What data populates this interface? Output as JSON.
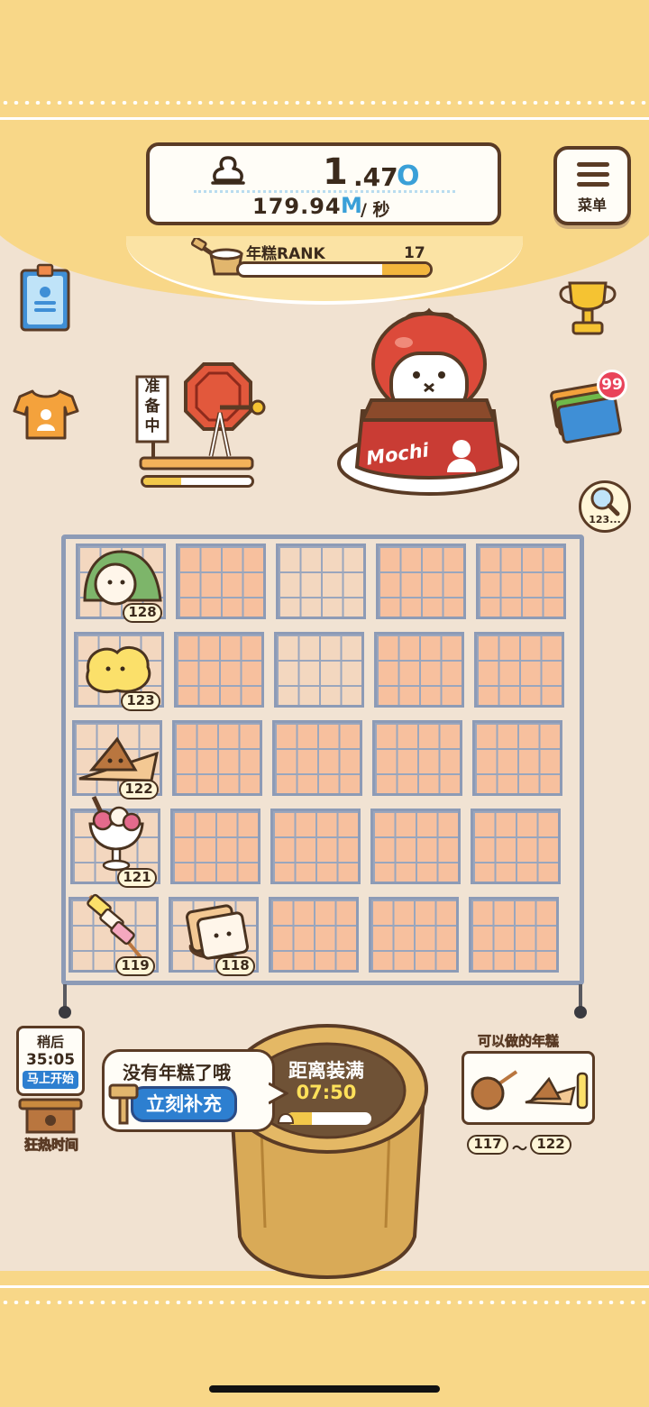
{
  "stats": {
    "mochi_count_int": "1",
    "mochi_count_frac": ".47",
    "mochi_count_unit": "O",
    "rate_value": "179.94",
    "rate_unit": "M",
    "rate_per": "/ 秒"
  },
  "menu": {
    "label": "菜单"
  },
  "rank": {
    "label": "年糕RANK",
    "level": "17",
    "progress": 0.25
  },
  "machine": {
    "sign": [
      "准",
      "备",
      "中"
    ],
    "progress": 0.35
  },
  "stall": {
    "sign_text": "Mochi"
  },
  "cards": {
    "badge": "99"
  },
  "search": {
    "label": "123..."
  },
  "grid": {
    "rows": 5,
    "cols": 5,
    "items": [
      {
        "row": 0,
        "col": 0,
        "level": "128",
        "kind": "green-wrapped-mochi"
      },
      {
        "row": 1,
        "col": 0,
        "level": "123",
        "kind": "yellow-mochi"
      },
      {
        "row": 2,
        "col": 0,
        "level": "122",
        "kind": "triangle-mochi"
      },
      {
        "row": 3,
        "col": 0,
        "level": "121",
        "kind": "mochi-parfait"
      },
      {
        "row": 4,
        "col": 0,
        "level": "119",
        "kind": "mochi-skewer"
      },
      {
        "row": 4,
        "col": 1,
        "level": "118",
        "kind": "mochi-toast"
      }
    ]
  },
  "fever": {
    "line1": "稍后",
    "countdown": "35:05",
    "start_label": "马上开始",
    "title": "狂热时间"
  },
  "refill": {
    "message": "没有年糕了哦",
    "button": "立刻补充",
    "fill_label": "距离装满",
    "fill_time": "07:50",
    "fill_progress": 0.3
  },
  "can_make": {
    "title": "可以做的年糕",
    "range_from": "117",
    "range_sep": "～",
    "range_to": "122"
  },
  "colors": {
    "band": "#f8d788",
    "background": "#f1e2d1",
    "accent_blue": "#3aa0d8",
    "button_blue": "#2d7fd0",
    "outline": "#5a3b25"
  }
}
